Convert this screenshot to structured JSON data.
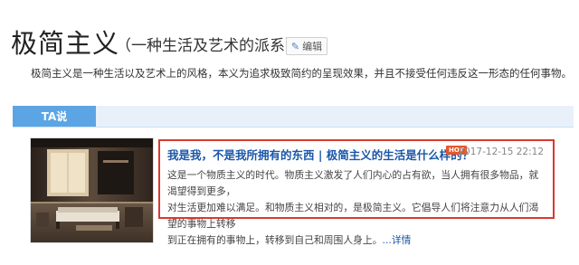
{
  "header": {
    "title": "极简主义",
    "subtitle": "（一种生活及艺术的派系）",
    "edit_label": "编辑",
    "edit_icon": "pencil-icon"
  },
  "summary": "极简主义是一种生活以及艺术上的风格，本义为追求极致简约的呈现效果，并且不接受任何违反这一形态的任何事物。",
  "tabs": [
    {
      "label": "TA说",
      "active": true
    }
  ],
  "article": {
    "title": "我是我，不是我所拥有的东西 | 极简主义的生活是什么样的？",
    "badge": "HOT",
    "date": "2017-12-15 22:12",
    "body_lines": [
      "这是一个物质主义的时代。物质主义激发了人们内心的占有欲，当人拥有很多物品，就渴望得到更多，",
      "对生活更加难以满足。和物质主义相对的，是极简主义。它倡导人们将注意力从人们渴望的事物上转移",
      "到正在拥有的事物上，转移到自己和周围人身上。"
    ],
    "more_label": "...详情",
    "image_alt": "minimalist-interior-photo"
  },
  "colors": {
    "accent_blue": "#5ba5e5",
    "tab_strip": "#e8f1fa",
    "link_blue": "#1a56a8",
    "highlight_red": "#d83a30",
    "hot_orange": "#e5572b"
  }
}
